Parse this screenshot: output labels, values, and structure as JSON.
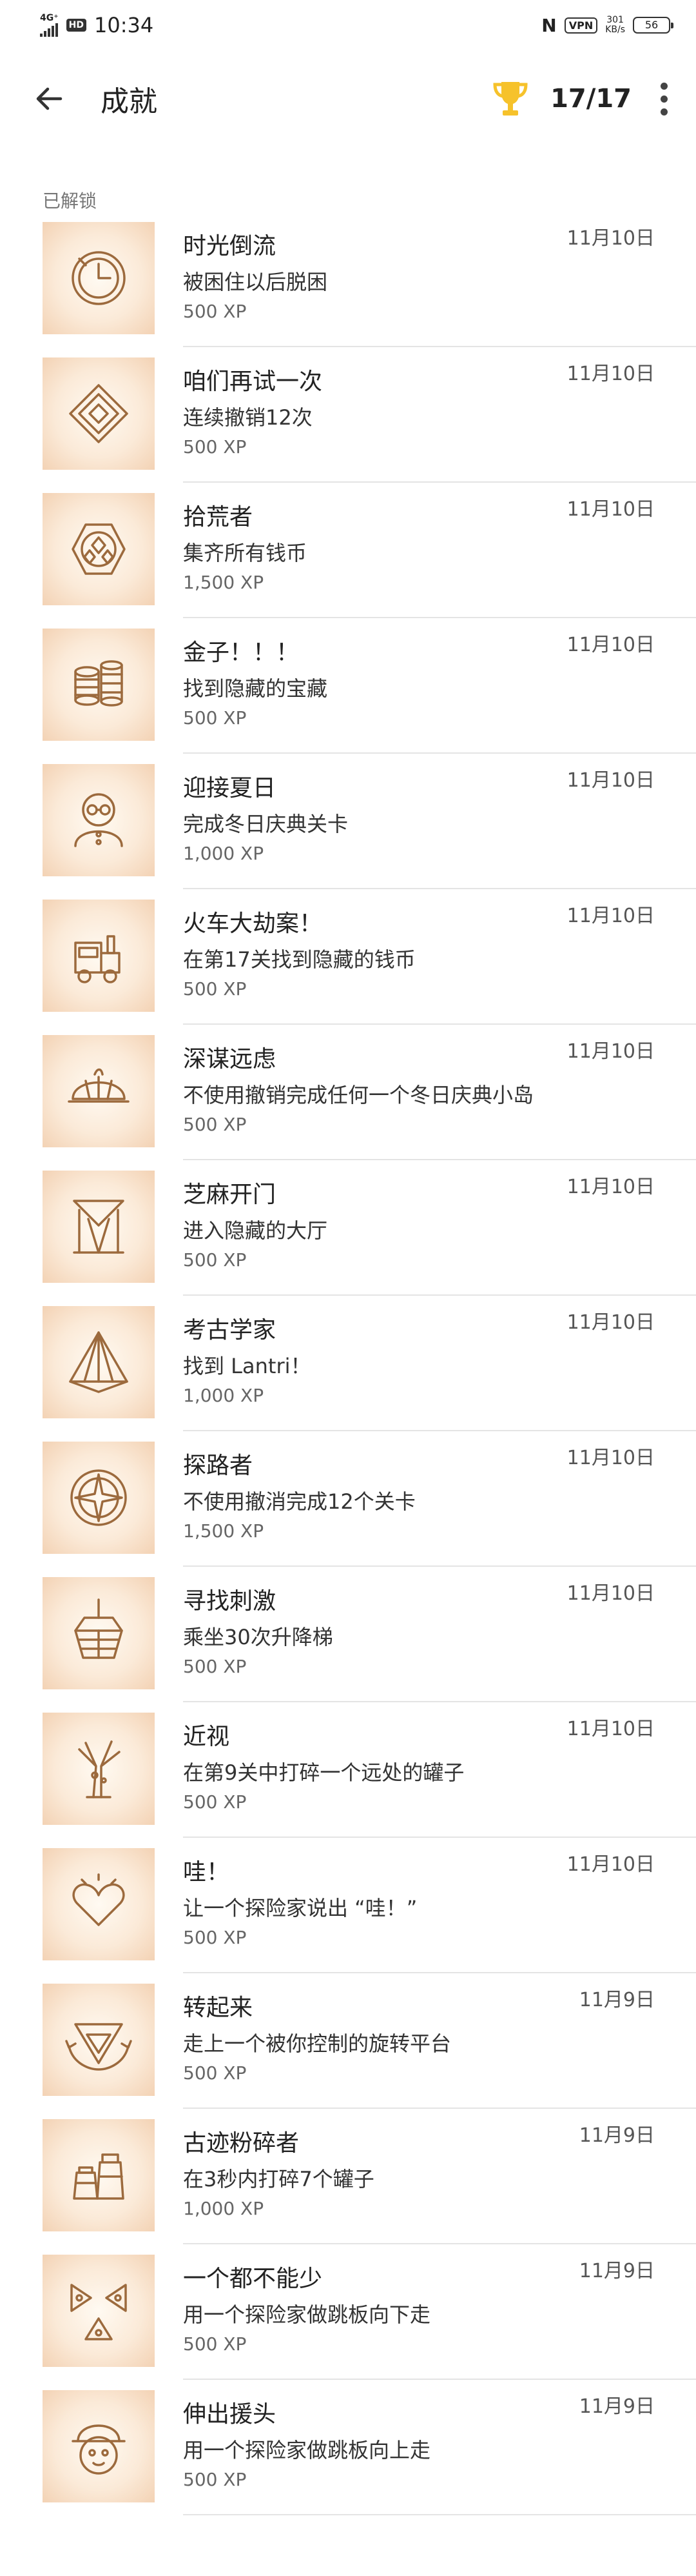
{
  "status_bar": {
    "network": "4G⁺",
    "hd": "HD",
    "time": "10:34",
    "nfc": "N",
    "vpn": "VPN",
    "speed_value": "301",
    "speed_unit": "KB/s",
    "battery": "56"
  },
  "header": {
    "back_icon": "arrow-left-icon",
    "title": "成就",
    "trophy_icon": "trophy-icon",
    "trophy_color": "#F6C22B",
    "progress": "17/17",
    "more_icon": "more-vertical-icon"
  },
  "section_label": "已解锁",
  "achievements": [
    {
      "name": "时光倒流",
      "desc": "被困住以后脱困",
      "xp": "500 XP",
      "date": "11月10日",
      "icon": "clock-icon"
    },
    {
      "name": "咱们再试一次",
      "desc": "连续撤销12次",
      "xp": "500 XP",
      "date": "11月10日",
      "icon": "maze-icon"
    },
    {
      "name": "拾荒者",
      "desc": "集齐所有钱币",
      "xp": "1,500 XP",
      "date": "11月10日",
      "icon": "coin-emblem-icon"
    },
    {
      "name": "金子！！！",
      "desc": "找到隐藏的宝藏",
      "xp": "500 XP",
      "date": "11月10日",
      "icon": "coin-stacks-icon"
    },
    {
      "name": "迎接夏日",
      "desc": "完成冬日庆典关卡",
      "xp": "1,000 XP",
      "date": "11月10日",
      "icon": "snowman-icon"
    },
    {
      "name": "火车大劫案！",
      "desc": "在第17关找到隐藏的钱币",
      "xp": "500 XP",
      "date": "11月10日",
      "icon": "train-icon"
    },
    {
      "name": "深谋远虑",
      "desc": "不使用撤销完成任何一个冬日庆典小岛",
      "xp": "500 XP",
      "date": "11月10日",
      "icon": "deerstalker-hat-icon"
    },
    {
      "name": "芝麻开门",
      "desc": "进入隐藏的大厅",
      "xp": "500 XP",
      "date": "11月10日",
      "icon": "gate-icon"
    },
    {
      "name": "考古学家",
      "desc": "找到 Lantri！",
      "xp": "1,000 XP",
      "date": "11月10日",
      "icon": "pyramid-icon"
    },
    {
      "name": "探路者",
      "desc": "不使用撤消完成12个关卡",
      "xp": "1,500 XP",
      "date": "11月10日",
      "icon": "compass-icon"
    },
    {
      "name": "寻找刺激",
      "desc": "乘坐30次升降梯",
      "xp": "500 XP",
      "date": "11月10日",
      "icon": "elevator-icon"
    },
    {
      "name": "近视",
      "desc": "在第9关中打碎一个远处的罐子",
      "xp": "500 XP",
      "date": "11月10日",
      "icon": "tree-icon"
    },
    {
      "name": "哇！",
      "desc": "让一个探险家说出 “哇！”",
      "xp": "500 XP",
      "date": "11月10日",
      "icon": "heart-icon"
    },
    {
      "name": "转起来",
      "desc": "走上一个被你控制的旋转平台",
      "xp": "500 XP",
      "date": "11月9日",
      "icon": "rotate-icon"
    },
    {
      "name": "古迹粉碎者",
      "desc": "在3秒内打碎7个罐子",
      "xp": "1,000 XP",
      "date": "11月9日",
      "icon": "jars-icon"
    },
    {
      "name": "一个都不能少",
      "desc": "用一个探险家做跳板向下走",
      "xp": "500 XP",
      "date": "11月9日",
      "icon": "triangles-icon"
    },
    {
      "name": "伸出援头",
      "desc": "用一个探险家做跳板向上走",
      "xp": "500 XP",
      "date": "11月9日",
      "icon": "explorer-head-icon"
    }
  ]
}
